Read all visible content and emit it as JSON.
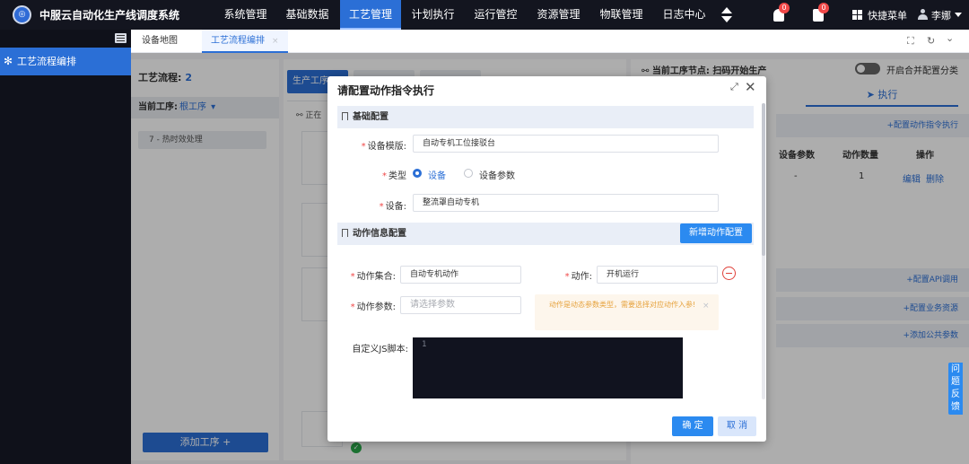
{
  "app": {
    "title": "中服云自动化生产线调度系统",
    "logo_icon": "company-logo-icon"
  },
  "nav": {
    "items": [
      {
        "label": "系统管理"
      },
      {
        "label": "基础数据"
      },
      {
        "label": "工艺管理",
        "active": true
      },
      {
        "label": "计划执行"
      },
      {
        "label": "运行管控"
      },
      {
        "label": "资源管理"
      },
      {
        "label": "物联管理"
      },
      {
        "label": "日志中心"
      }
    ]
  },
  "header": {
    "bell_badge": "0",
    "task_badge": "0",
    "quick_menu": "快捷菜单",
    "user_name": "李娜"
  },
  "sidebar": {
    "items": [
      {
        "label": "工艺流程编排",
        "active": true
      }
    ]
  },
  "tabs": [
    {
      "label": "设备地图",
      "active": false
    },
    {
      "label": "工艺流程编排",
      "active": true,
      "close": "×"
    }
  ],
  "tab_tools": {
    "fullscreen": "⛶",
    "refresh": "↻",
    "collapse": "⌄"
  },
  "left_panel": {
    "flow_label": "工艺流程:",
    "flow_count": "2",
    "current_label": "当前工序:",
    "current_value": "根工序",
    "process_items": [
      "7 - 热时效处理"
    ],
    "add_button": "添加工序 +"
  },
  "mid_panel": {
    "tab_label": "生产工序",
    "running_label": "正在"
  },
  "right_panel": {
    "node_title": "当前工序节点: 扫码开始生产",
    "toggle_label": "开启合并配置分类",
    "exec_tab": "执行",
    "config_action_link": "+配置动作指令执行",
    "table_headers": [
      "设备参数",
      "动作数量",
      "操作"
    ],
    "table_row": {
      "param": "-",
      "count": "1",
      "edit": "编辑",
      "delete": "删除"
    },
    "config_api_link": "+配置API调用",
    "config_biz_link": "+配置业务资源",
    "add_public_param_link": "+添加公共参数"
  },
  "feedback": {
    "label": "问题反馈"
  },
  "dialog": {
    "title": "请配置动作指令执行",
    "maximize_icon": "⤢",
    "close_icon": "✕",
    "basic_section": "基础配置",
    "template_label": "设备模版:",
    "template_value": "自动专机工位接驳台",
    "type_label": "类型",
    "type_options": [
      {
        "label": "设备",
        "selected": true
      },
      {
        "label": "设备参数",
        "selected": false
      }
    ],
    "device_label": "设备:",
    "device_value": "整流罩自动专机",
    "action_section": "动作信息配置",
    "add_action_button": "新增动作配置",
    "action_set_label": "动作集合:",
    "action_set_value": "自动专机动作",
    "action_label": "动作:",
    "action_value": "开机运行",
    "action_param_label": "动作参数:",
    "action_param_placeholder": "请选择参数",
    "warning_text": "动作是动态参数类型，需要选择对应动作入参!",
    "warning_close": "×",
    "js_label": "自定义JS脚本:",
    "js_line_number": "1",
    "ok_button": "确 定",
    "cancel_button": "取 消"
  }
}
